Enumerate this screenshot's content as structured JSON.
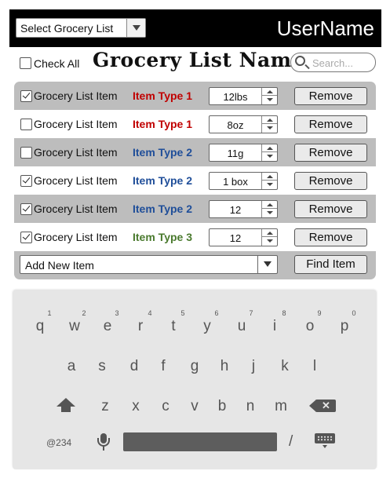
{
  "header": {
    "list_select": "Select Grocery List",
    "username": "UserName"
  },
  "toolbar": {
    "check_all_label": "Check All",
    "check_all_checked": false,
    "title": "Grocery List Name",
    "search_placeholder": "Search..."
  },
  "items": [
    {
      "checked": true,
      "name": "Grocery List Item",
      "type": "Item Type 1",
      "type_color": "#c00000",
      "qty": "12lbs",
      "remove": "Remove",
      "bg": "gray"
    },
    {
      "checked": false,
      "name": "Grocery List Item",
      "type": "Item Type 1",
      "type_color": "#c00000",
      "qty": "8oz",
      "remove": "Remove",
      "bg": "white"
    },
    {
      "checked": false,
      "name": "Grocery List Item",
      "type": "Item Type 2",
      "type_color": "#1f4e99",
      "qty": "11g",
      "remove": "Remove",
      "bg": "gray"
    },
    {
      "checked": true,
      "name": "Grocery List Item",
      "type": "Item Type 2",
      "type_color": "#1f4e99",
      "qty": "1 box",
      "remove": "Remove",
      "bg": "white"
    },
    {
      "checked": true,
      "name": "Grocery List Item",
      "type": "Item Type 2",
      "type_color": "#1f4e99",
      "qty": "12",
      "remove": "Remove",
      "bg": "gray"
    },
    {
      "checked": true,
      "name": "Grocery List Item",
      "type": "Item Type 3",
      "type_color": "#4a7a2e",
      "qty": "12",
      "remove": "Remove",
      "bg": "white"
    }
  ],
  "add_item": {
    "select_value": "Add New Item",
    "find_label": "Find Item"
  },
  "keyboard": {
    "row1": [
      {
        "k": "q",
        "h": "1"
      },
      {
        "k": "w",
        "h": "2"
      },
      {
        "k": "e",
        "h": "3"
      },
      {
        "k": "r",
        "h": "4"
      },
      {
        "k": "t",
        "h": "5"
      },
      {
        "k": "y",
        "h": "6"
      },
      {
        "k": "u",
        "h": "7"
      },
      {
        "k": "i",
        "h": "8"
      },
      {
        "k": "o",
        "h": "9"
      },
      {
        "k": "p",
        "h": "0"
      }
    ],
    "row2": [
      "a",
      "s",
      "d",
      "f",
      "g",
      "h",
      "j",
      "k",
      "l"
    ],
    "row3": [
      "z",
      "x",
      "c",
      "v",
      "b",
      "n",
      "m"
    ],
    "symbols_label": "@234",
    "slash_label": "/",
    "icons": [
      "shift-icon",
      "backspace-icon",
      "microphone-icon",
      "keyboard-hide-icon"
    ]
  }
}
